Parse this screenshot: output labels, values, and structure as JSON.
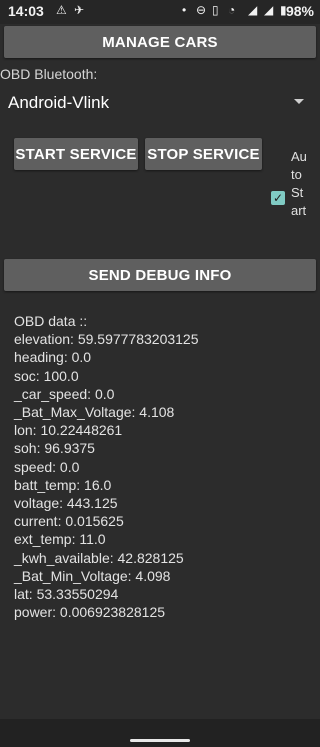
{
  "status_bar": {
    "time": "14:03",
    "battery": "98%"
  },
  "buttons": {
    "manage_cars": "MANAGE CARS",
    "start_service": "START SERVICE",
    "stop_service": "STOP SERVICE",
    "send_debug": "SEND DEBUG INFO"
  },
  "obd_bluetooth": {
    "label": "OBD Bluetooth:",
    "selected": "Android-Vlink"
  },
  "auto_start": {
    "label": "Auto Start",
    "checked": true
  },
  "obd_data": {
    "header": "OBD data ::",
    "lines": [
      "elevation: 59.5977783203125",
      "heading: 0.0",
      "soc: 100.0",
      "_car_speed: 0.0",
      "_Bat_Max_Voltage: 4.108",
      "lon: 10.22448261",
      "soh: 96.9375",
      "speed: 0.0",
      "batt_temp: 16.0",
      "voltage: 443.125",
      "current: 0.015625",
      "ext_temp: 11.0",
      "_kwh_available: 42.828125",
      "_Bat_Min_Voltage: 4.098",
      "lat: 53.33550294",
      "power: 0.006923828125"
    ]
  },
  "colors": {
    "background": "#2c2c2c",
    "button": "#5f5f5f",
    "checkbox_accent": "#80cbc4"
  }
}
